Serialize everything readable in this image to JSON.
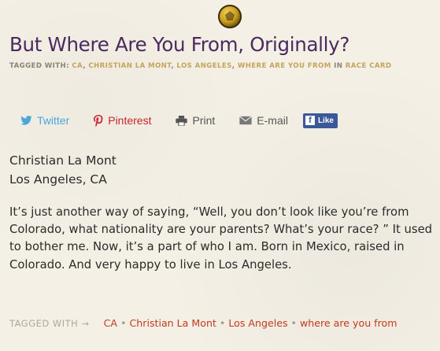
{
  "post": {
    "title": "But Where Are You From, Originally?",
    "tagged_label": "TAGGED WITH:",
    "tags": [
      "CA",
      "CHRISTIAN LA MONT",
      "LOS ANGELES",
      "WHERE ARE YOU FROM"
    ],
    "in_label": "IN",
    "category": "RACE CARD"
  },
  "share": {
    "twitter": "Twitter",
    "pinterest": "Pinterest",
    "print": "Print",
    "email": "E-mail",
    "facebook_like": "Like"
  },
  "content": {
    "name": "Christian La Mont",
    "location": "Los Angeles, CA",
    "paragraph": "It’s just another way of saying, “Well, you don’t look like you’re from Colorado, what nationality are your parents? What’s your race? ” It used to bother me. Now, it’s a part of who I am. Born in Mexico, raised in Colorado. And very happy to live in Los Angeles."
  },
  "footer_tags": {
    "lead": "TAGGED WITH →",
    "tags": [
      "CA",
      "Christian La Mont",
      "Los Angeles",
      "where are you from"
    ]
  },
  "colors": {
    "title": "#4a2a5e",
    "tag_link": "#c6a35b",
    "footer_link": "#c23a1f",
    "twitter": "#4aa7d8",
    "pinterest": "#c8232c",
    "facebook": "#3b5998"
  }
}
